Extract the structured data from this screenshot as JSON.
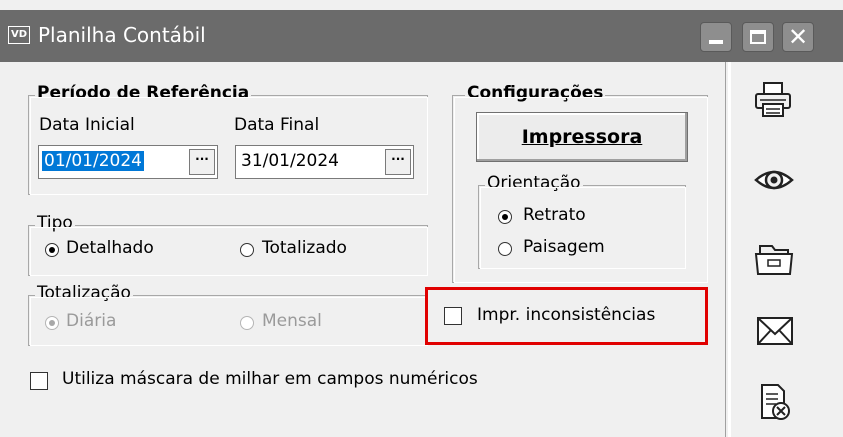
{
  "window": {
    "app_icon_text": "VD",
    "title": "Planilha Contábil",
    "close_glyph": "✕"
  },
  "periodo": {
    "legend": "Período de Referência",
    "data_inicial_label": "Data Inicial",
    "data_inicial_value": "01/01/2024",
    "data_final_label": "Data Final",
    "data_final_value": "31/01/2024",
    "picker_glyph": "···"
  },
  "configuracoes": {
    "legend": "Configurações",
    "impressora_button": "Impressora",
    "orientacao_legend": "Orientação",
    "retrato": "Retrato",
    "paisagem": "Paisagem",
    "selected": "Retrato"
  },
  "tipo": {
    "legend": "Tipo",
    "detalhado": "Detalhado",
    "totalizado": "Totalizado",
    "selected": "Detalhado"
  },
  "totalizacao": {
    "legend": "Totalização",
    "diaria": "Diária",
    "mensal": "Mensal",
    "selected": "Diária",
    "enabled": false
  },
  "checkboxes": {
    "impr_inconsistencias": "Impr. inconsistências",
    "mascara_milhar": "Utiliza máscara de milhar em campos numéricos"
  },
  "toolbar": {
    "icons": [
      "printer-icon",
      "preview-eye-icon",
      "folder-icon",
      "email-icon",
      "cancel-document-icon"
    ]
  },
  "colors": {
    "titlebar": "#6b6b6b",
    "selection": "#0078d7",
    "highlight_box": "#e00000"
  }
}
